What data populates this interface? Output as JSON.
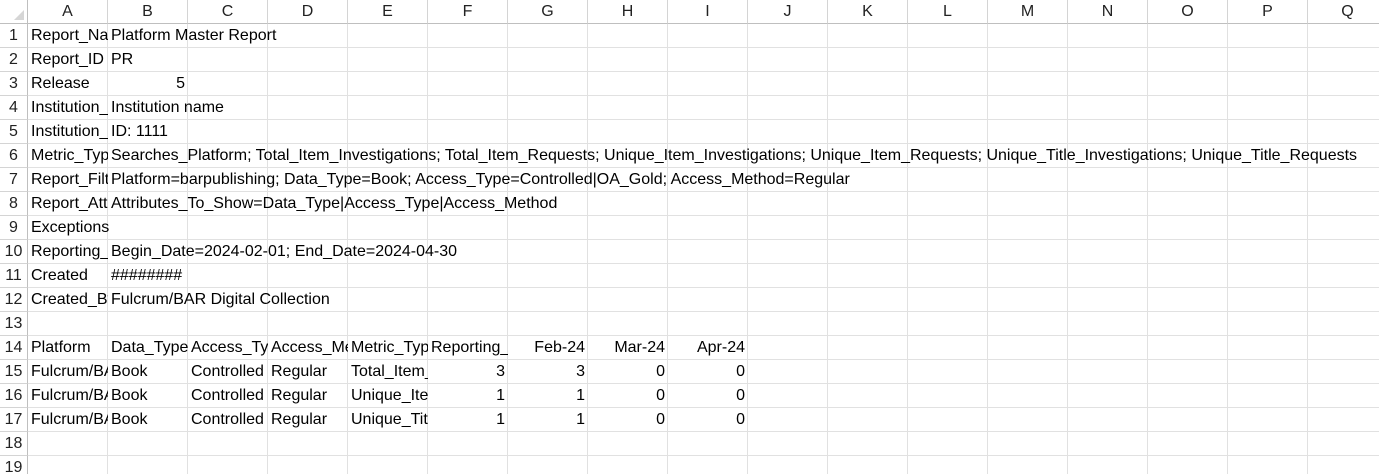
{
  "columns": [
    "A",
    "B",
    "C",
    "D",
    "E",
    "F",
    "G",
    "H",
    "I",
    "J",
    "K",
    "L",
    "M",
    "N",
    "O",
    "P",
    "Q"
  ],
  "rows": [
    "1",
    "2",
    "3",
    "4",
    "5",
    "6",
    "7",
    "8",
    "9",
    "10",
    "11",
    "12",
    "13",
    "14",
    "15",
    "16",
    "17",
    "18",
    "19"
  ],
  "cells": {
    "r1": {
      "a": "Report_Name",
      "b": "Platform Master Report"
    },
    "r2": {
      "a": "Report_ID",
      "b": "PR"
    },
    "r3": {
      "a": "Release",
      "b": "5"
    },
    "r4": {
      "a": "Institution_Name",
      "b": "Institution name"
    },
    "r5": {
      "a": "Institution_ID",
      "b": "ID: 1111"
    },
    "r6": {
      "a": "Metric_Types",
      "b": "Searches_Platform; Total_Item_Investigations; Total_Item_Requests; Unique_Item_Investigations; Unique_Item_Requests; Unique_Title_Investigations; Unique_Title_Requests"
    },
    "r7": {
      "a": "Report_Filters",
      "b": "Platform=barpublishing; Data_Type=Book; Access_Type=Controlled|OA_Gold; Access_Method=Regular"
    },
    "r8": {
      "a": "Report_Attributes",
      "b": "Attributes_To_Show=Data_Type|Access_Type|Access_Method"
    },
    "r9": {
      "a": "Exceptions"
    },
    "r10": {
      "a": "Reporting_Period",
      "b": "Begin_Date=2024-02-01; End_Date=2024-04-30"
    },
    "r11": {
      "a": "Created",
      "b": "########"
    },
    "r12": {
      "a": "Created_By",
      "b": "Fulcrum/BAR Digital Collection"
    },
    "r14": {
      "a": "Platform",
      "b": "Data_Type",
      "c": "Access_Type",
      "d": "Access_Method",
      "e": "Metric_Type",
      "f": "Reporting_Period_Total",
      "g": "Feb-24",
      "h": "Mar-24",
      "i": "Apr-24"
    },
    "r15": {
      "a": "Fulcrum/BAR Digital Collection",
      "b": "Book",
      "c": "Controlled",
      "d": "Regular",
      "e": "Total_Item_Requests",
      "f": "3",
      "g": "3",
      "h": "0",
      "i": "0"
    },
    "r16": {
      "a": "Fulcrum/BAR Digital Collection",
      "b": "Book",
      "c": "Controlled",
      "d": "Regular",
      "e": "Unique_Item_Requests",
      "f": "1",
      "g": "1",
      "h": "0",
      "i": "0"
    },
    "r17": {
      "a": "Fulcrum/BAR Digital Collection",
      "b": "Book",
      "c": "Controlled",
      "d": "Regular",
      "e": "Unique_Title_Requests",
      "f": "1",
      "g": "1",
      "h": "0",
      "i": "0"
    }
  }
}
